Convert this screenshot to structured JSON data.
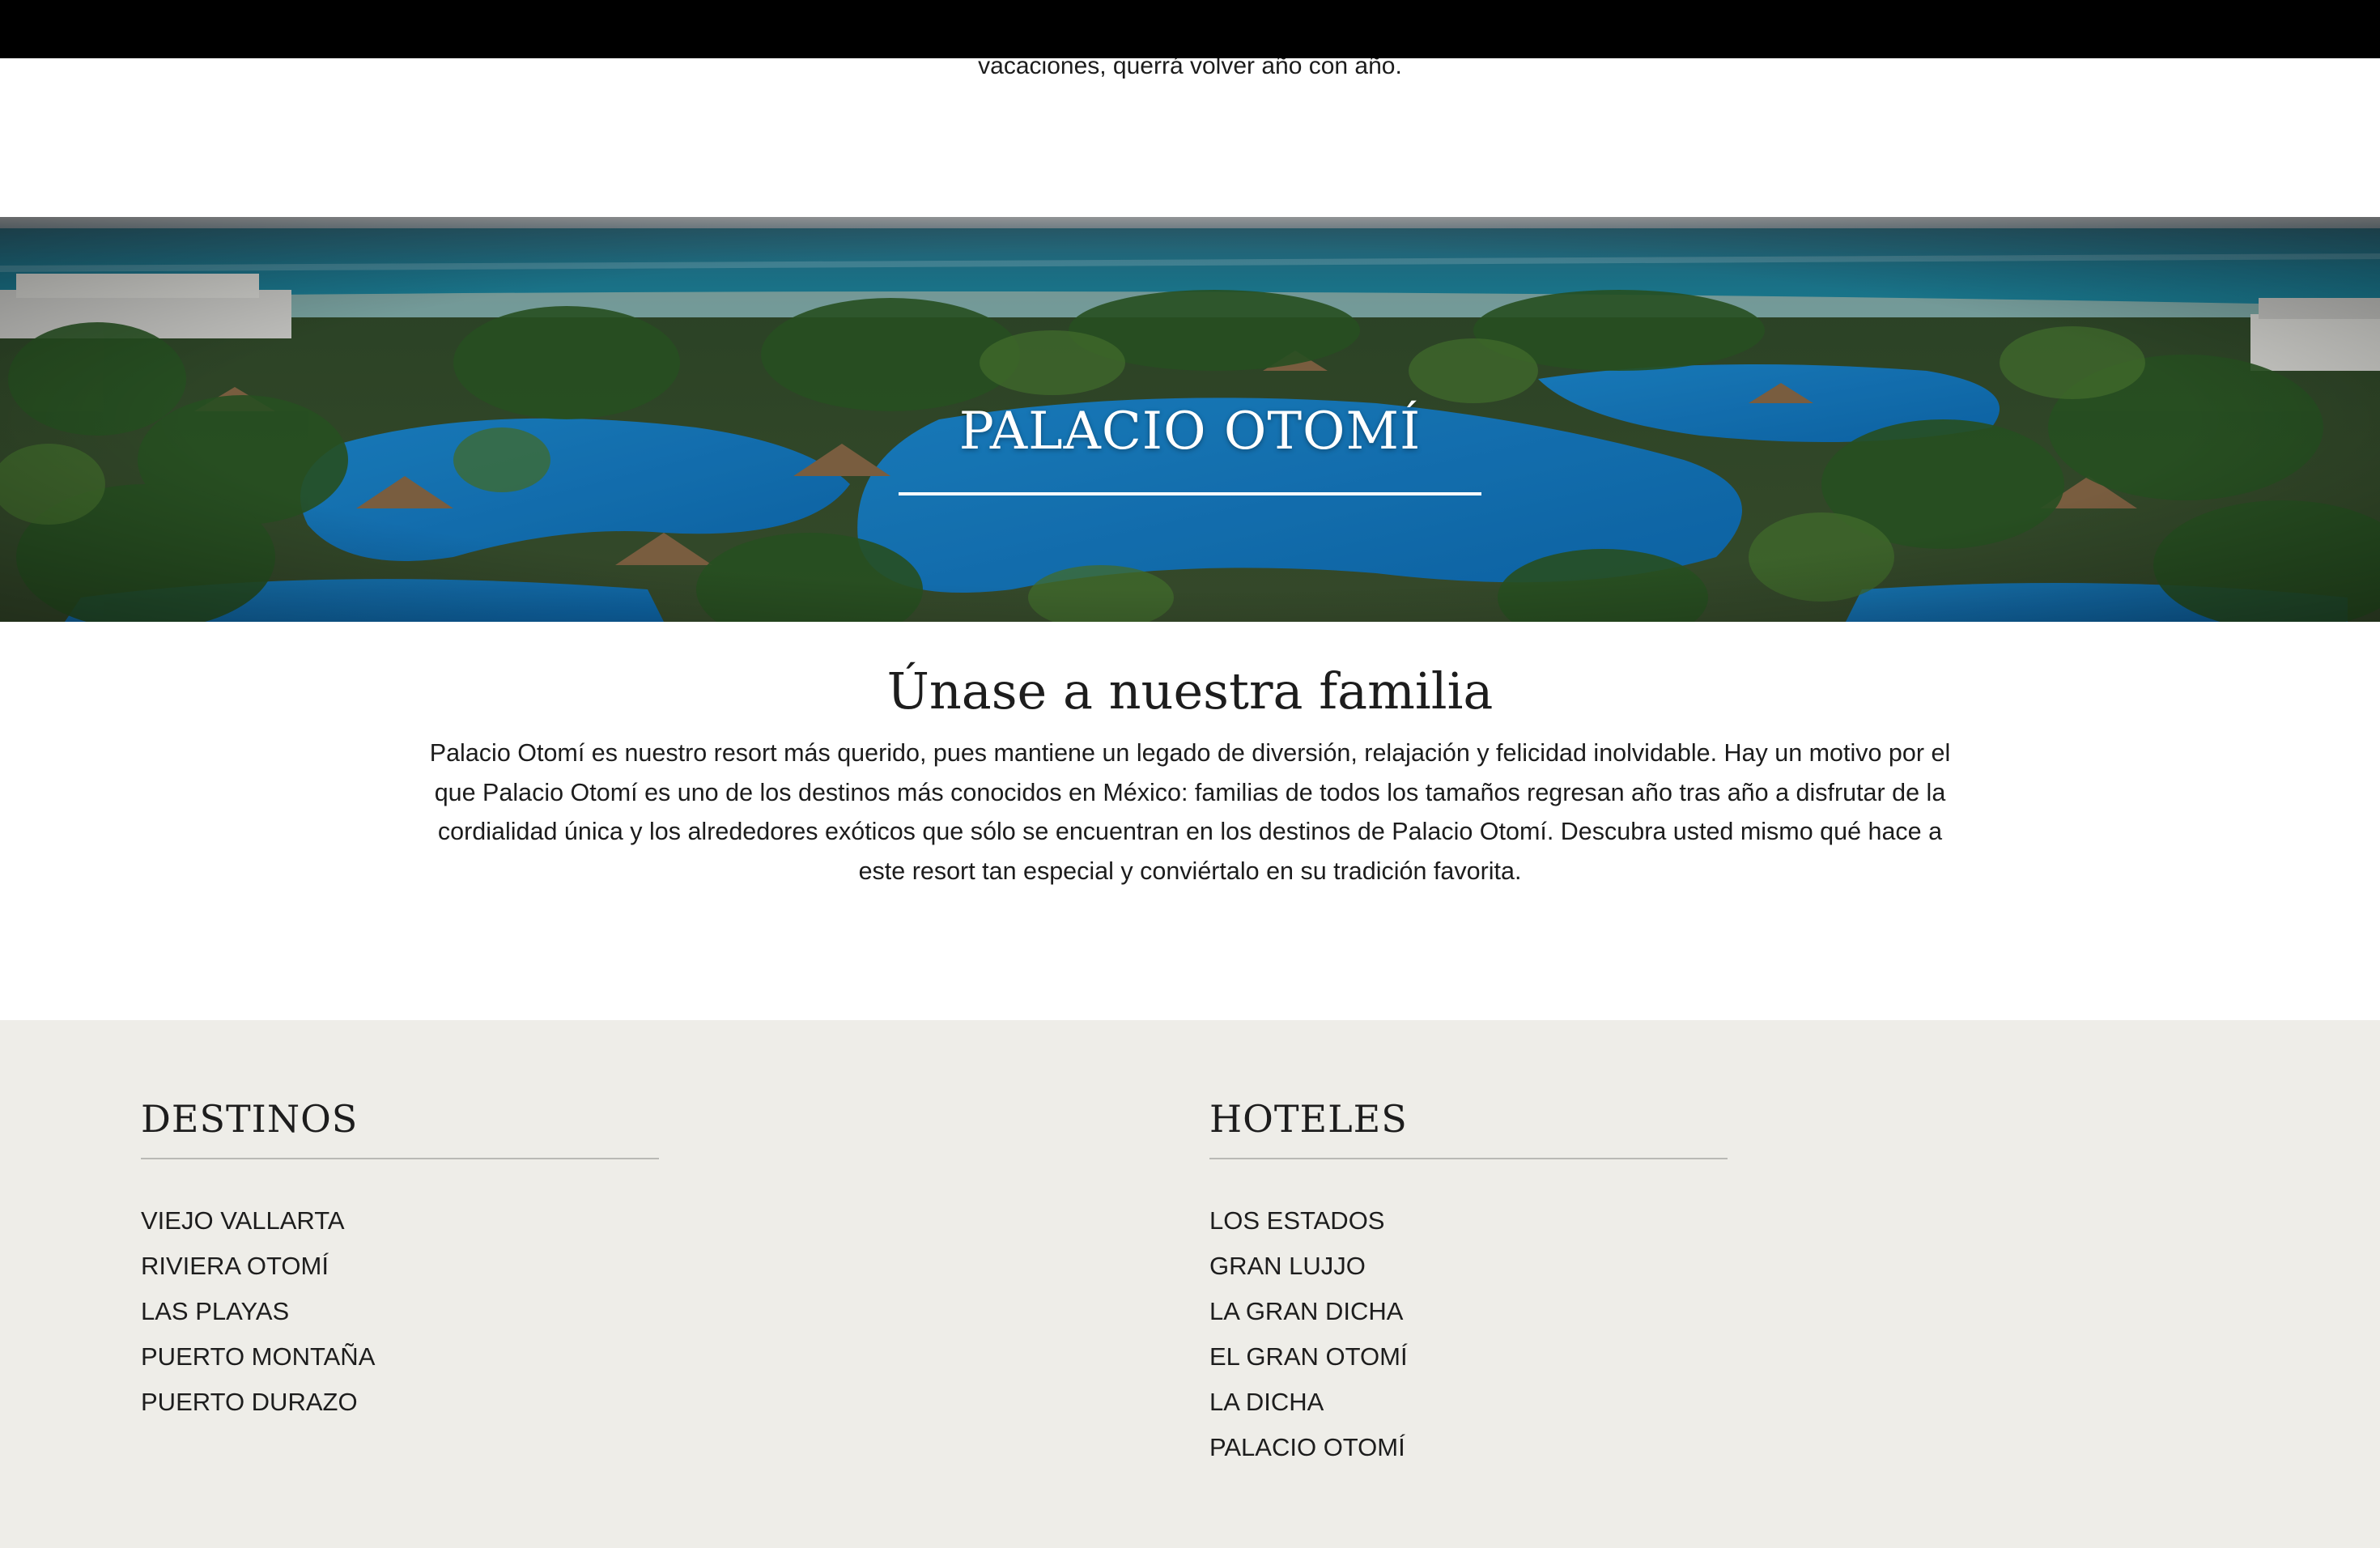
{
  "intro": {
    "tail_text": "vacaciones, querrá volver año con año."
  },
  "hero": {
    "title": "PALACIO OTOMÍ"
  },
  "family": {
    "heading": "Únase a nuestra familia",
    "body": "Palacio Otomí es nuestro resort más querido, pues mantiene un legado de diversión, relajación y felicidad inolvidable. Hay un motivo por el que Palacio Otomí es uno de los destinos más conocidos en México: familias de todos los tamaños regresan año tras año a disfrutar de la cordialidad única y los alrededores exóticos que sólo se encuentran en los destinos de Palacio Otomí. Descubra usted mismo qué hace a este resort tan especial y conviértalo en su tradición favorita."
  },
  "footer": {
    "destinos": {
      "heading": "DESTINOS",
      "items": [
        "VIEJO VALLARTA",
        "RIVIERA OTOMÍ",
        "LAS PLAYAS",
        "PUERTO MONTAÑA",
        "PUERTO DURAZO"
      ]
    },
    "hoteles": {
      "heading": "HOTELES",
      "items": [
        "LOS ESTADOS",
        "GRAN LUJJO",
        "LA GRAN DICHA",
        "EL GRAN OTOMÍ",
        "LA DICHA",
        "PALACIO OTOMÍ"
      ]
    }
  },
  "colors": {
    "footer_bg": "#eeede8",
    "text": "#1c1c1c",
    "topbar": "#000000"
  }
}
